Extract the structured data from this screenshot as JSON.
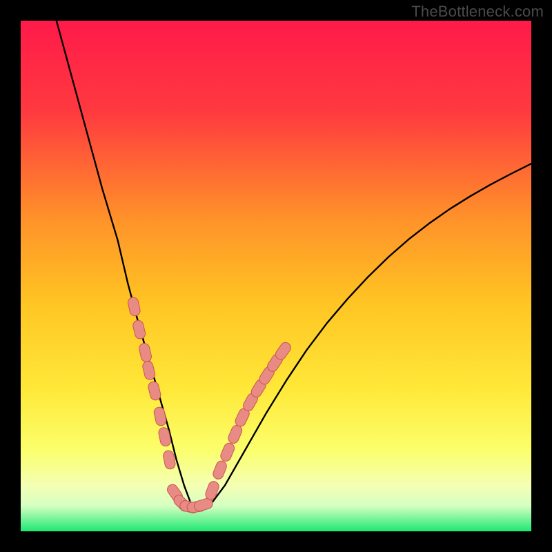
{
  "watermark": "TheBottleneck.com",
  "colors": {
    "bg": "#000000",
    "gradient_top": "#ff1a4a",
    "gradient_mid_upper": "#ff7a2a",
    "gradient_mid": "#ffd21f",
    "gradient_mid_lower": "#fff44a",
    "gradient_pale": "#f7ffb0",
    "gradient_bottom": "#1ee873",
    "curve": "#000000",
    "marker_fill": "#e98b85",
    "marker_stroke": "#c9544f"
  },
  "chart_data": {
    "type": "line",
    "title": "",
    "xlabel": "",
    "ylabel": "",
    "xlim": [
      0,
      100
    ],
    "ylim": [
      0,
      100
    ],
    "grid": false,
    "legend": false,
    "series": [
      {
        "name": "bottleneck-curve",
        "x": [
          7,
          10,
          13,
          16,
          19,
          21,
          23,
          25,
          27,
          29,
          30.5,
          32,
          33.5,
          37,
          40,
          44,
          48,
          52,
          56,
          60,
          64,
          68,
          72,
          76,
          80,
          84,
          88,
          92,
          96,
          100
        ],
        "y": [
          100,
          89,
          78,
          67,
          57,
          48.5,
          41,
          34,
          27,
          20,
          14,
          9,
          5,
          5,
          9,
          16,
          23,
          29.5,
          35.5,
          40.8,
          45.5,
          49.8,
          53.7,
          57.2,
          60.3,
          63.1,
          65.6,
          67.9,
          70,
          72
        ]
      }
    ],
    "markers": [
      {
        "name": "left-branch-markers",
        "x": [
          22.2,
          23.2,
          24.4,
          25.1,
          26.2,
          27.3,
          28.2,
          29.1
        ],
        "y": [
          44.0,
          39.5,
          35.0,
          31.5,
          27.5,
          22.5,
          18.5,
          14.0
        ]
      },
      {
        "name": "valley-markers",
        "x": [
          30.2,
          31.6,
          33.0,
          34.4,
          35.8
        ],
        "y": [
          7.5,
          5.5,
          4.8,
          4.8,
          5.2
        ]
      },
      {
        "name": "right-branch-markers",
        "x": [
          37.5,
          39.0,
          40.5,
          42.0,
          43.4,
          45.0,
          46.6,
          48.2,
          49.8,
          51.4
        ],
        "y": [
          8.0,
          12.0,
          15.5,
          19.0,
          22.3,
          25.3,
          28.0,
          30.5,
          33.0,
          35.3
        ]
      }
    ]
  }
}
